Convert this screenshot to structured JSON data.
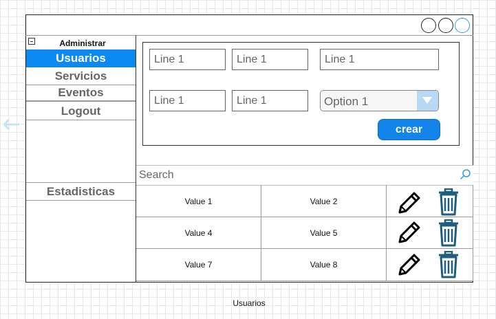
{
  "window": {
    "controls": [
      "minimize",
      "maximize",
      "close"
    ]
  },
  "sidebar": {
    "header": "Administrar",
    "items": [
      {
        "label": "Usuarios",
        "selected": true
      },
      {
        "label": "Servicios",
        "selected": false
      },
      {
        "label": "Eventos",
        "selected": false
      },
      {
        "label": "Logout",
        "selected": false
      }
    ],
    "section2": "Estadisticas"
  },
  "form": {
    "field1": "Line 1",
    "field2": "Line 1",
    "field3": "Line 1",
    "field4": "Line 1",
    "field5": "Line 1",
    "select_value": "Option 1",
    "create_label": "crear"
  },
  "search": {
    "placeholder": "Search"
  },
  "table": {
    "rows": [
      {
        "c1": "Value 1",
        "c2": "Value 2"
      },
      {
        "c1": "Value 4",
        "c2": "Value 5"
      },
      {
        "c1": "Value 7",
        "c2": "Value 8"
      }
    ],
    "row_actions": [
      "pencil-icon",
      "trash-icon"
    ]
  },
  "caption": "Usuarios",
  "colors": {
    "accent": "#0b89f0",
    "button": "#1385ea",
    "trash": "#1d5d7d",
    "select_arrow_bg": "#b8d8f4"
  }
}
